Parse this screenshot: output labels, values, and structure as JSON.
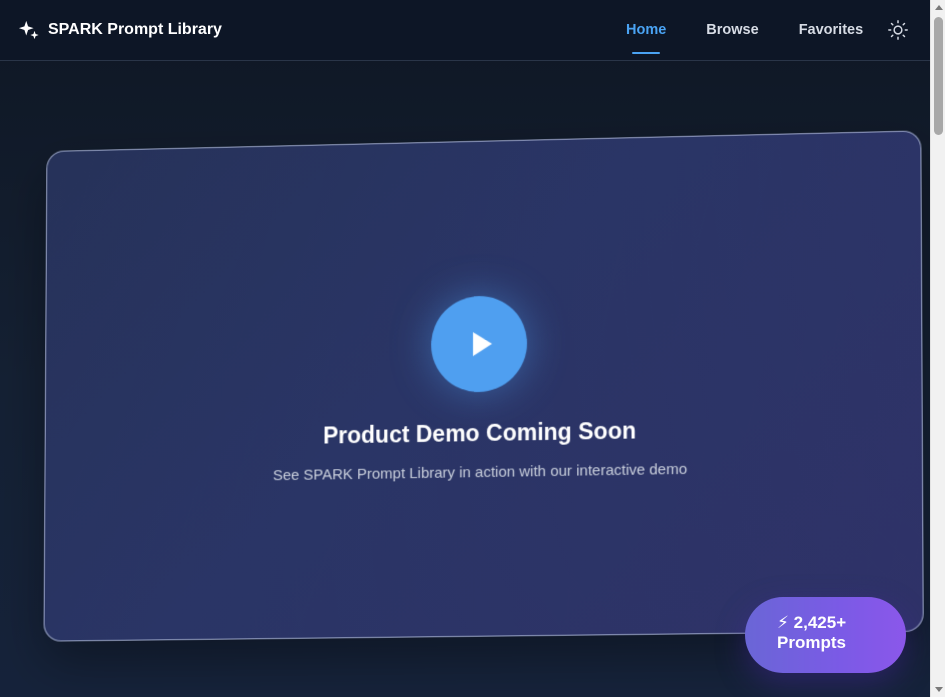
{
  "header": {
    "title": "SPARK Prompt Library",
    "nav": [
      {
        "label": "Home",
        "active": true
      },
      {
        "label": "Browse",
        "active": false
      },
      {
        "label": "Favorites",
        "active": false
      }
    ],
    "logo_icon": "sparkles-icon",
    "theme_icon": "sun-icon",
    "accent_color": "#4aa3f3"
  },
  "demo": {
    "title": "Product Demo Coming Soon",
    "subtitle": "See SPARK Prompt Library in action with our interactive demo",
    "play_icon": "play-icon",
    "play_color": "#4f9ff0"
  },
  "badge": {
    "text": "⚡ 2,425+ Prompts"
  }
}
